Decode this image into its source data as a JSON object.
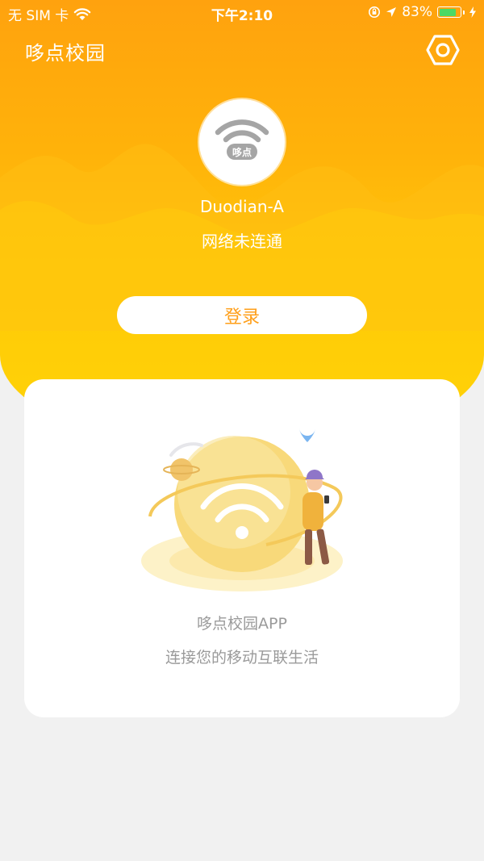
{
  "status_bar": {
    "carrier": "无 SIM 卡",
    "time": "下午2:10",
    "battery_percent": "83%",
    "battery_level": 0.83,
    "battery_color": "#4cd964",
    "icons": [
      "wifi-icon",
      "orientation-lock-icon",
      "location-icon",
      "battery-icon",
      "charging-icon"
    ]
  },
  "header": {
    "title": "哆点校园",
    "settings_icon": "gear-icon"
  },
  "network": {
    "logo_label": "哆点",
    "ssid": "Duodian-A",
    "status": "网络未连通"
  },
  "login": {
    "label": "登录"
  },
  "promo": {
    "title": "哆点校园APP",
    "subtitle": "连接您的移动互联生活"
  },
  "colors": {
    "brand_orange": "#ffa20e",
    "brand_yellow": "#ffd406",
    "login_text": "#ff9f1a"
  }
}
